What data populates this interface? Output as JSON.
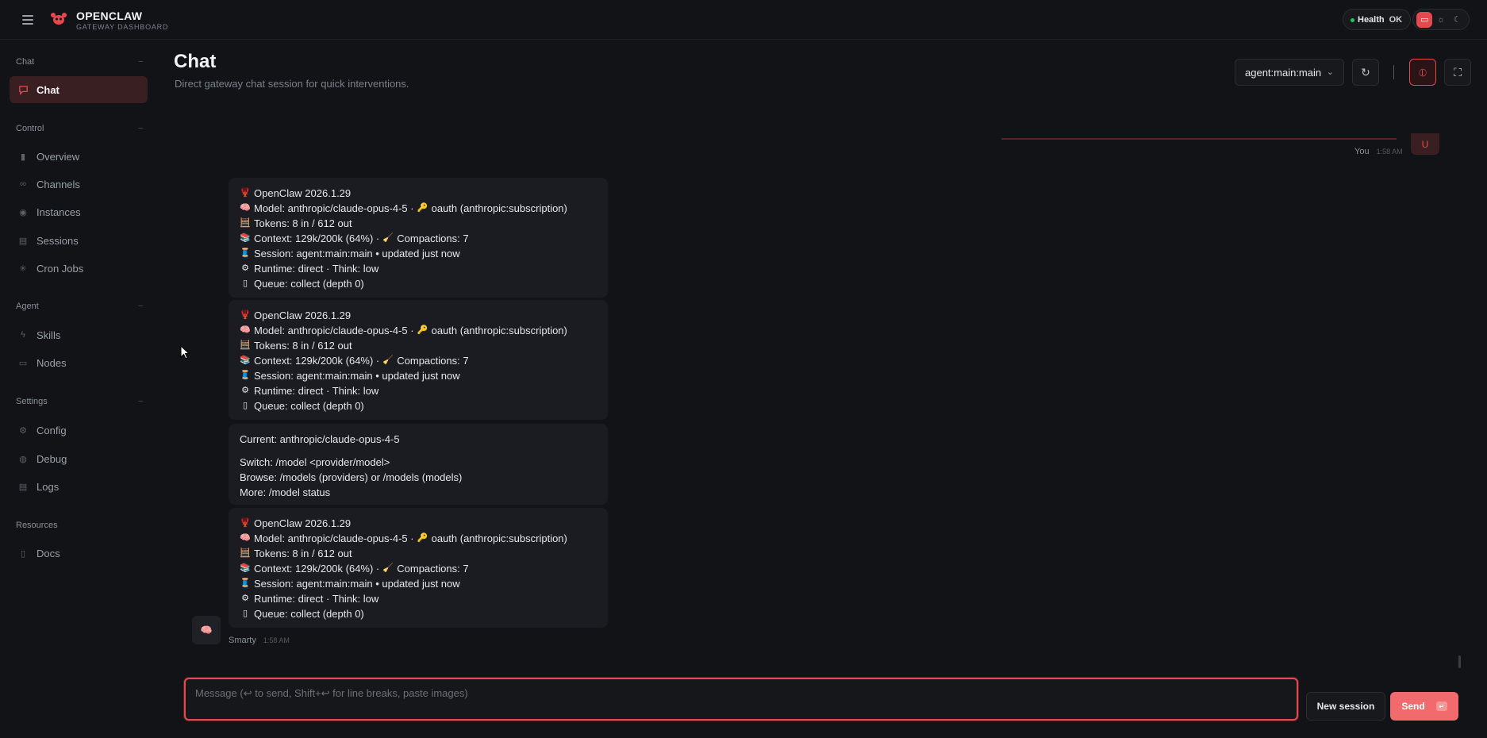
{
  "app": {
    "brand_name": "OPENCLAW",
    "brand_sub": "GATEWAY DASHBOARD",
    "health_label": "Health",
    "health_status": "OK",
    "accent_color": "#e5484d"
  },
  "sidebar": {
    "groups": [
      {
        "title": "Chat",
        "items": [
          {
            "label": "Chat",
            "icon": "message-icon",
            "active": true
          }
        ]
      },
      {
        "title": "Control",
        "items": [
          {
            "label": "Overview",
            "icon": "bar-chart-icon"
          },
          {
            "label": "Channels",
            "icon": "link-icon"
          },
          {
            "label": "Instances",
            "icon": "broadcast-icon"
          },
          {
            "label": "Sessions",
            "icon": "document-icon"
          },
          {
            "label": "Cron Jobs",
            "icon": "loader-icon"
          }
        ]
      },
      {
        "title": "Agent",
        "items": [
          {
            "label": "Skills",
            "icon": "lightning-icon"
          },
          {
            "label": "Nodes",
            "icon": "monitor-icon"
          }
        ]
      },
      {
        "title": "Settings",
        "items": [
          {
            "label": "Config",
            "icon": "gear-icon"
          },
          {
            "label": "Debug",
            "icon": "bug-icon"
          },
          {
            "label": "Logs",
            "icon": "scroll-icon"
          }
        ]
      },
      {
        "title": "Resources",
        "items": [
          {
            "label": "Docs",
            "icon": "book-icon"
          }
        ]
      }
    ]
  },
  "header": {
    "title": "Chat",
    "subtitle": "Direct gateway chat session for quick interventions.",
    "session_value": "agent:main:main"
  },
  "messages": {
    "user_author": "You",
    "user_time": "1:58 AM",
    "user_avatar": "U",
    "bot_author": "Smarty",
    "bot_time": "1:58 AM",
    "status_block": {
      "version": "OpenClaw 2026.1.29",
      "model": "Model: anthropic/claude-opus-4-5 ·",
      "auth": "oauth (anthropic:subscription)",
      "tokens": "Tokens: 8 in / 612 out",
      "context": "Context: 129k/200k (64%) ·",
      "compactions": "Compactions: 7",
      "session": "Session: agent:main:main • updated just now",
      "runtime": "Runtime: direct · Think: low",
      "queue": "Queue: collect (depth 0)"
    },
    "model_block": {
      "current": "Current: anthropic/claude-opus-4-5",
      "switch": "Switch: /model <provider/model>",
      "browse": "Browse: /models (providers) or /models (models)",
      "more": "More: /model status"
    }
  },
  "composer": {
    "placeholder": "Message (↩ to send, Shift+↩ for line breaks, paste images)",
    "new_session_label": "New session",
    "send_label": "Send"
  }
}
